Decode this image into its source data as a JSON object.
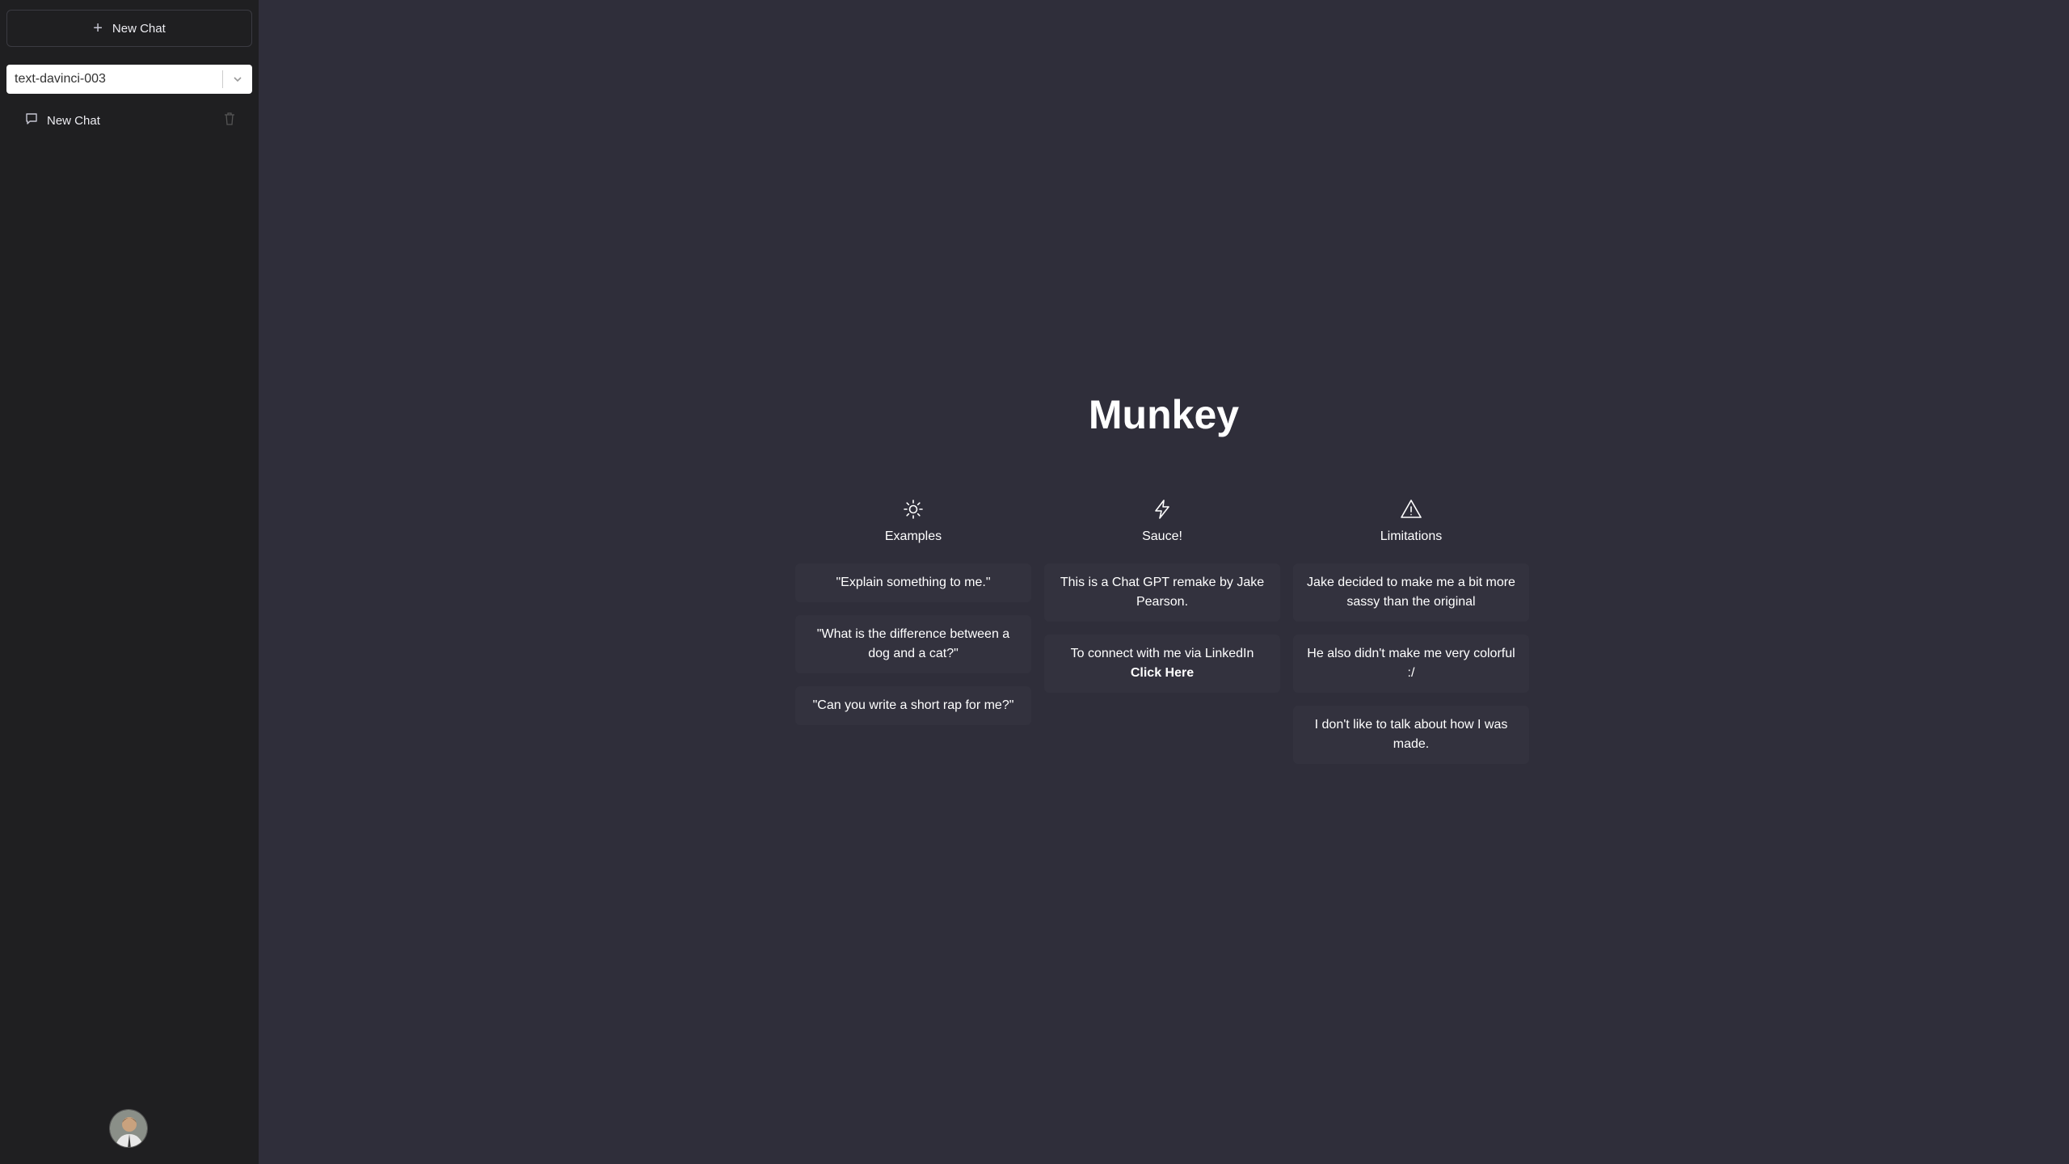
{
  "sidebar": {
    "new_chat_label": "New Chat",
    "model_select": {
      "value": "text-davinci-003"
    },
    "chats": [
      {
        "label": "New Chat"
      }
    ]
  },
  "main": {
    "title": "Munkey",
    "columns": [
      {
        "heading": "Examples",
        "icon": "sun-icon",
        "cards": [
          "\"Explain something to me.\"",
          "\"What is the difference between a dog and a cat?\"",
          "\"Can you write a short rap for me?\""
        ]
      },
      {
        "heading": "Sauce!",
        "icon": "lightning-icon",
        "cards": [
          "This is a Chat GPT remake by Jake Pearson.",
          "To connect with me via LinkedIn"
        ],
        "link_label": "Click Here"
      },
      {
        "heading": "Limitations",
        "icon": "warning-icon",
        "cards": [
          "Jake decided to make me a bit more sassy than the original",
          "He also didn't make me very colorful :/",
          "I don't like to talk about how I was made."
        ]
      }
    ]
  },
  "colors": {
    "main_bg": "#2f2e3a",
    "sidebar_bg": "#1f1f21",
    "card_bg": "#33323e"
  }
}
